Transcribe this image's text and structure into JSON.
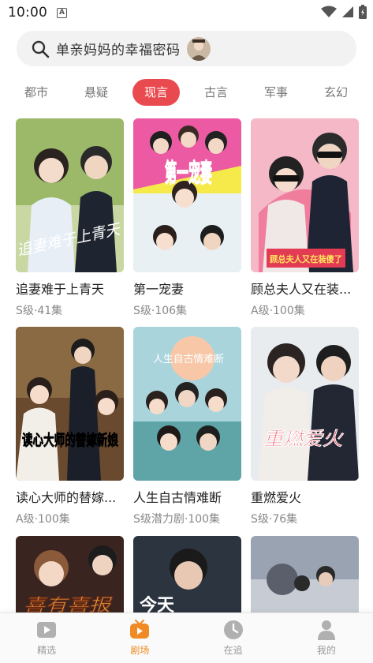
{
  "status": {
    "time": "10:00",
    "notif_letter": "A"
  },
  "search": {
    "query": "单亲妈妈的幸福密码"
  },
  "tabs": [
    {
      "label": "都市",
      "active": false
    },
    {
      "label": "悬疑",
      "active": false
    },
    {
      "label": "现言",
      "active": true
    },
    {
      "label": "古言",
      "active": false
    },
    {
      "label": "军事",
      "active": false
    },
    {
      "label": "玄幻",
      "active": false
    }
  ],
  "cards": [
    {
      "title": "追妻难于上青天",
      "meta": "S级·41集",
      "poster_text": "追妻难于上青天"
    },
    {
      "title": "第一宠妻",
      "meta": "S级·106集",
      "poster_text": "第一宠妻"
    },
    {
      "title": "顾总夫人又在装...",
      "meta": "A级·100集",
      "poster_text": "顾总夫人又在装傻了"
    },
    {
      "title": "读心大师的替嫁...",
      "meta": "A级·100集",
      "poster_text": "读心大师的替嫁新娘"
    },
    {
      "title": "人生自古情难断",
      "meta": "S级潜力剧·100集",
      "poster_text": "人生自古情难断"
    },
    {
      "title": "重燃爱火",
      "meta": "S级·76集",
      "poster_text": "重燃爱火"
    },
    {
      "title": "",
      "meta": "",
      "poster_text": "喜有喜报"
    },
    {
      "title": "",
      "meta": "",
      "poster_text": "今天"
    },
    {
      "title": "",
      "meta": "",
      "poster_text": ""
    }
  ],
  "nav": [
    {
      "label": "精选",
      "icon": "play-square-icon",
      "active": false
    },
    {
      "label": "剧场",
      "icon": "tv-icon",
      "active": true
    },
    {
      "label": "在追",
      "icon": "clock-icon",
      "active": false
    },
    {
      "label": "我的",
      "icon": "person-icon",
      "active": false
    }
  ],
  "colors": {
    "accent_red": "#e94a4f",
    "accent_orange": "#f08a24"
  }
}
